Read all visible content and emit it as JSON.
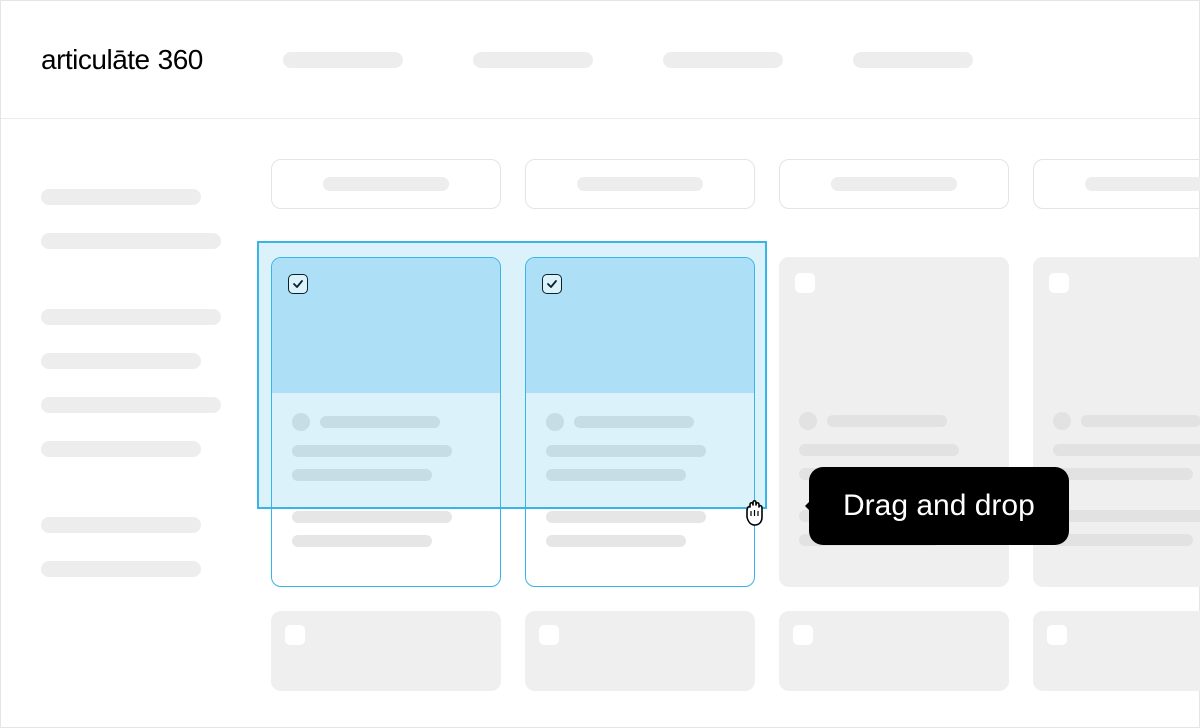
{
  "brand": {
    "word": "articulāte",
    "suffix": "360"
  },
  "tooltip": {
    "text": "Drag and drop"
  },
  "cards": {
    "row1": [
      {
        "selected": true
      },
      {
        "selected": true
      },
      {
        "selected": false
      },
      {
        "selected": false
      }
    ]
  }
}
